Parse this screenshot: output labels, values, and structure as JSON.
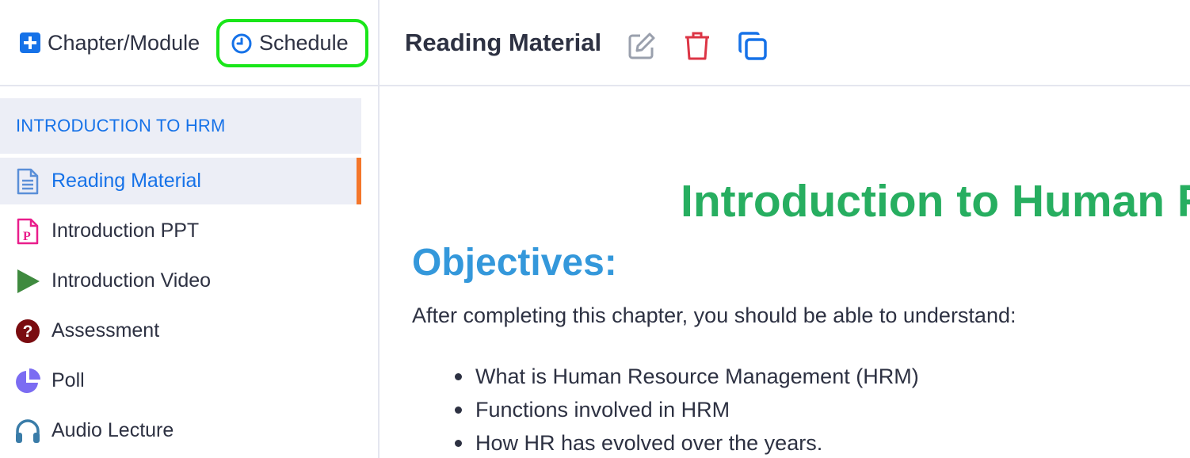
{
  "toolbar": {
    "chapter_module_label": "Chapter/Module",
    "schedule_label": "Schedule"
  },
  "header": {
    "title": "Reading Material",
    "icons": [
      "edit-icon",
      "trash-icon",
      "copy-icon"
    ]
  },
  "sidebar": {
    "chapter_title": "INTRODUCTION TO HRM",
    "items": [
      {
        "label": "Reading Material",
        "icon": "document-icon",
        "active": true
      },
      {
        "label": "Introduction PPT",
        "icon": "ppt-icon",
        "active": false
      },
      {
        "label": "Introduction Video",
        "icon": "play-icon",
        "active": false
      },
      {
        "label": "Assessment",
        "icon": "question-icon",
        "active": false
      },
      {
        "label": "Poll",
        "icon": "pie-chart-icon",
        "active": false
      },
      {
        "label": "Audio Lecture",
        "icon": "headphones-icon",
        "active": false
      }
    ]
  },
  "content": {
    "title": "Introduction to Human Re",
    "objectives_heading": "Objectives:",
    "intro": "After completing this chapter, you should be able to understand:",
    "bullets": [
      "What is Human Resource Management (HRM)",
      "Functions involved in HRM",
      "How HR has evolved over the years."
    ]
  },
  "colors": {
    "accent_blue": "#1672e8",
    "title_green": "#27ae60",
    "heading_blue": "#3498db",
    "highlight_green": "#19e619",
    "active_marker": "#f4762a",
    "delete_red": "#dc3545"
  }
}
